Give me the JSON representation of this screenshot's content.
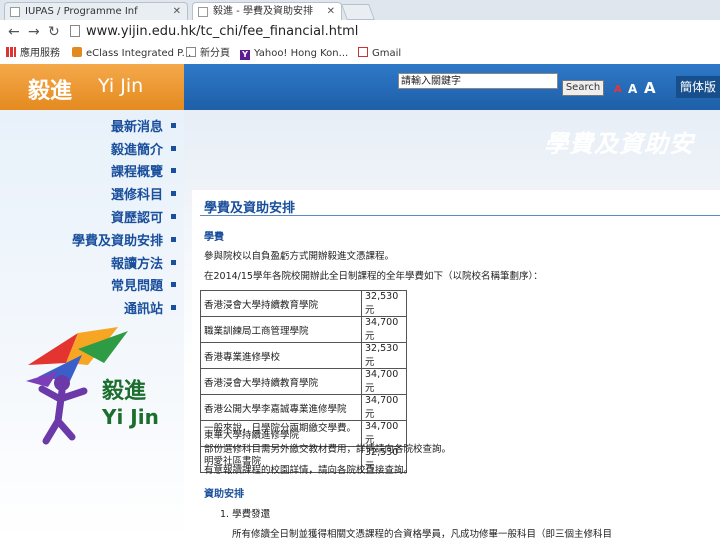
{
  "browser": {
    "tabs": [
      {
        "title": "IUPAS / Programme Inf"
      },
      {
        "title": "毅進 - 學費及資助安排"
      }
    ],
    "url": "www.yijin.edu.hk/tc_chi/fee_financial.html",
    "bookmarks": [
      {
        "label": "應用服務"
      },
      {
        "label": "eClass Integrated P..."
      },
      {
        "label": "新分頁"
      },
      {
        "label": "Yahoo! Hong Kon..."
      },
      {
        "label": "Gmail"
      }
    ]
  },
  "header": {
    "logo_zh": "毅進",
    "logo_en": "Yi Jin",
    "search_value": "請輸入關鍵字",
    "search_button": "Search",
    "font_small": "A",
    "font_medium": "A",
    "font_large": "A",
    "lang_button": "簡体版"
  },
  "sidebar": {
    "items": [
      {
        "label": "最新消息"
      },
      {
        "label": "毅進簡介"
      },
      {
        "label": "課程概覽"
      },
      {
        "label": "選修科目"
      },
      {
        "label": "資歷認可"
      },
      {
        "label": "學費及資助安排"
      },
      {
        "label": "報讀方法"
      },
      {
        "label": "常見問題"
      },
      {
        "label": "通訊站"
      }
    ],
    "brand_zh": "毅進",
    "brand_en": "Yi Jin"
  },
  "main": {
    "banner": "學費及資助安",
    "page_title": "學費及資助安排",
    "fees_heading": "學費",
    "intro": "參與院校以自負盈虧方式開辦毅進文憑課程。",
    "table_intro": "在2014/15學年各院校開辦此全日制課程的全年學費如下（以院校名稱筆劃序）：",
    "fee_rows": [
      {
        "institution": "香港浸會大學持續教育學院",
        "fee": "32,530元"
      },
      {
        "institution": "職業訓練局工商管理學院",
        "fee": "34,700元"
      },
      {
        "institution": "香港專業進修學校",
        "fee": "32,530元"
      },
      {
        "institution": "香港浸會大學持續教育學院",
        "fee": "34,700元"
      },
      {
        "institution": "香港公開大學李嘉誠專業進修學院",
        "fee": "34,700元"
      },
      {
        "institution": "東華大學持續進修學院",
        "fee": "34,700元"
      },
      {
        "institution": "明愛社區書院",
        "fee": "32,530元"
      }
    ],
    "note1": "一般來說，日學院分兩期繳交學費。",
    "note2": "部份選修科目需另外繳交教材費用，詳情請向各院校查詢。",
    "note3": "有意報讀課程的校園詳情，請向各院校直接查詢。",
    "aid_heading": "資助安排",
    "aid_item1": "1.  學費發還",
    "aid_item1_text": "所有修讀全日制並獲得相關文憑課程的合資格學員，凡成功修畢一般科目（即三個主修科目"
  }
}
